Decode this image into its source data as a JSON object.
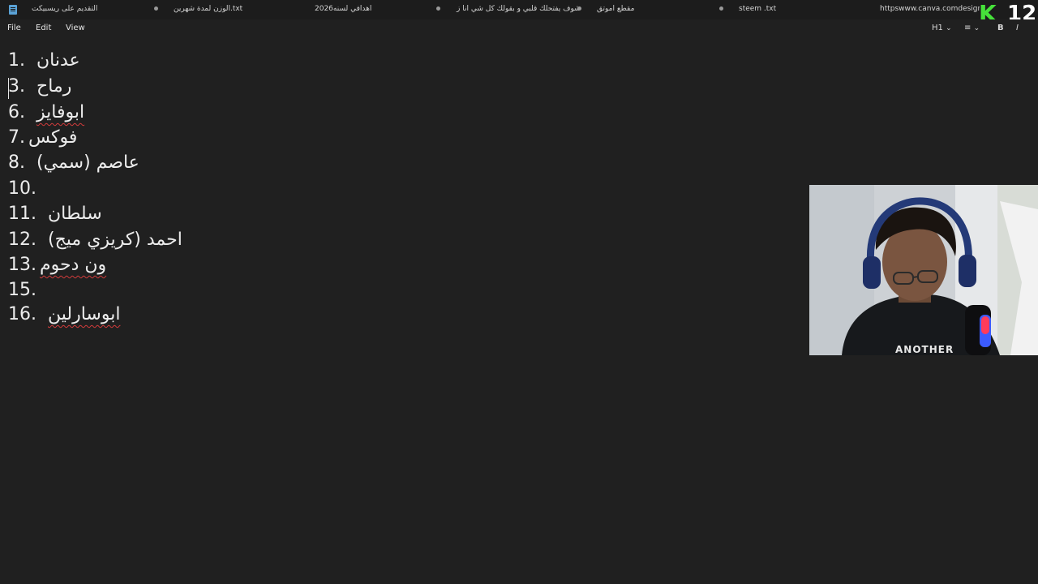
{
  "tabs": [
    {
      "title": "التقديم على ريسبيكت"
    },
    {
      "title": "الوزن لمدة شهرين.txt"
    },
    {
      "title": "اهدافي لسنه2026"
    },
    {
      "title": "شوف يفتحلك قلبي و بقولك كل شي انا ز"
    },
    {
      "title": "مقطع اموتق"
    },
    {
      "title": "steem .txt"
    },
    {
      "title": "httpswww.canva.comdesignDAH"
    }
  ],
  "menu": {
    "file": "File",
    "edit": "Edit",
    "view": "View"
  },
  "toolbar": {
    "heading": "H1",
    "heading_chevron": "⌄",
    "list_icon": "≡",
    "list_chevron": "⌄",
    "bold": "B",
    "italic": "I"
  },
  "logo": {
    "letter": "K",
    "number": "12"
  },
  "lines": [
    {
      "num": "1.",
      "text": "عدنان",
      "misspelled": false
    },
    {
      "num": "3.",
      "text": "رماح",
      "misspelled": false
    },
    {
      "num": "6.",
      "text": "ابوفايز",
      "misspelled": true
    },
    {
      "num": "7.",
      "text": "فوكس",
      "misspelled": false
    },
    {
      "num": "8.",
      "text": "عاصم (سمي)",
      "misspelled": false
    },
    {
      "num": "10.",
      "text": "",
      "misspelled": false
    },
    {
      "num": "11.",
      "text": "سلطان",
      "misspelled": false
    },
    {
      "num": "12.",
      "text": "احمد (كريزي ميج)",
      "misspelled": false
    },
    {
      "num": "13.",
      "text": "ون دحوم",
      "misspelled": true
    },
    {
      "num": "15.",
      "text": "",
      "misspelled": false
    },
    {
      "num": "16.",
      "text": "ابوسارلين",
      "misspelled": true
    }
  ],
  "webcam": {
    "shirt_text": "ANOTHER"
  },
  "colors": {
    "background": "#202020",
    "tabbar": "#1c1c1c",
    "text": "#ececec",
    "spellcheck": "#d23b3b",
    "logo_green": "#46e23a"
  }
}
